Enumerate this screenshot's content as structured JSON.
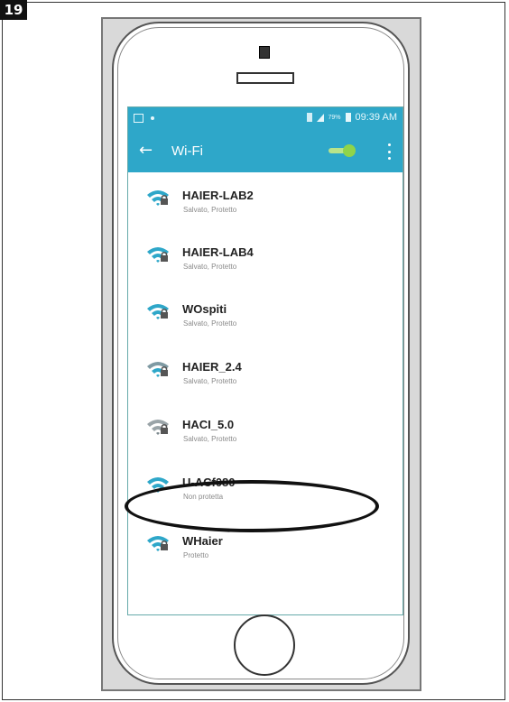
{
  "figure": {
    "step_number": "19"
  },
  "status_bar": {
    "battery_percent": "79%",
    "time": "09:39 AM"
  },
  "app_bar": {
    "back_icon": "arrow-left-icon",
    "title": "Wi-Fi",
    "toggle_state": "on",
    "menu_icon": "overflow-menu-icon"
  },
  "networks": [
    {
      "name": "HAIER-LAB2",
      "status": "Salvato, Protetto",
      "icon": "wifi-locked-icon"
    },
    {
      "name": "HAIER-LAB4",
      "status": "Salvato, Protetto",
      "icon": "wifi-locked-icon"
    },
    {
      "name": "WOspiti",
      "status": "Salvato, Protetto",
      "icon": "wifi-locked-icon"
    },
    {
      "name": "HAIER_2.4",
      "status": "Salvato, Protetto",
      "icon": "wifi-locked-icon"
    },
    {
      "name": "HACI_5.0",
      "status": "Salvato, Protetto",
      "icon": "wifi-locked-icon"
    },
    {
      "name": "U-ACf080",
      "status": "Non protetta",
      "icon": "wifi-open-icon",
      "highlighted": true
    },
    {
      "name": "WHaier",
      "status": "Protetto",
      "icon": "wifi-locked-icon"
    }
  ],
  "colors": {
    "app_bar": "#2ea7c9",
    "wifi_icon": "#2ea7c9",
    "toggle_on": "#8fd44a"
  }
}
